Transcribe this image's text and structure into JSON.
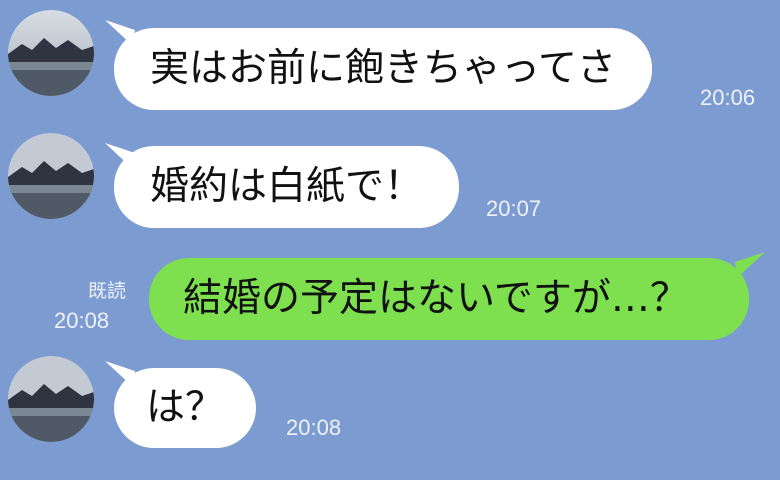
{
  "messages": [
    {
      "direction": "incoming",
      "text": "実はお前に飽きちゃってさ",
      "time": "20:06"
    },
    {
      "direction": "incoming",
      "text": "婚約は白紙で！",
      "time": "20:07"
    },
    {
      "direction": "outgoing",
      "text": "結婚の予定はないですが…？",
      "time": "20:08",
      "read_label": "既読"
    },
    {
      "direction": "incoming",
      "text": "は？",
      "time": "20:08"
    }
  ],
  "colors": {
    "background": "#7b9bd1",
    "incoming_bubble": "#ffffff",
    "outgoing_bubble": "#7ee04e"
  }
}
